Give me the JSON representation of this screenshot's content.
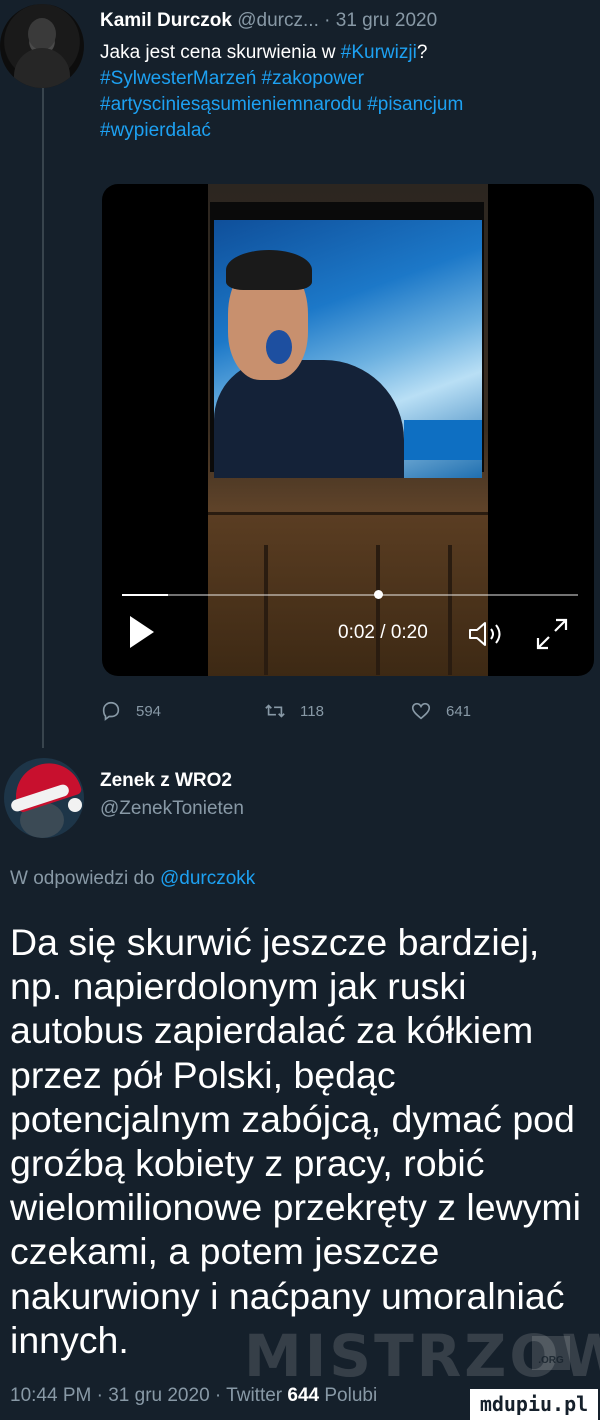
{
  "tweet": {
    "author_name": "Kamil Durczok",
    "author_handle": "@durcz...",
    "date": "· 31 gru 2020",
    "text_prefix": "Jaka jest cena skurwienia w ",
    "hashtag_kurwizji": "#Kurwizji",
    "text_q": "?",
    "hashtag_line2": "#SylwesterMarzeń #zakopower",
    "hashtag_line3": "#artysciniesąsumieniemnarodu #pisancjum",
    "hashtag_line4": "#wypierdalać"
  },
  "video": {
    "timecode": "0:02 / 0:20",
    "progress_fraction": 0.1,
    "play_icon": "play-icon",
    "volume_icon": "volume-icon",
    "expand_icon": "expand-icon"
  },
  "actions": {
    "reply_count": "594",
    "retweet_count": "118",
    "like_count": "641"
  },
  "reply": {
    "author_name": "Zenek z WRO2",
    "author_handle": "@ZenekTonieten",
    "replying_to_prefix": "W odpowiedzi do ",
    "replying_to_handle": "@durczokk",
    "text": "Da się skurwić jeszcze bardziej, np. napierdolonym jak ruski autobus zapierdalać za kółkiem przez pół Polski, będąc potencjalnym zabójcą, dymać pod groźbą kobiety z pracy, robić wielomilionowe przekręty z lewymi czekami, a potem jeszcze nakurwiony i naćpany umoralniać innych.",
    "footer_time": "10:44 PM · 31 gru 2020 · Twitter ",
    "footer_likes": "644",
    "footer_likes_label": " Polubi"
  },
  "watermark": {
    "text": "MISTRZOWIE",
    "org": ".ORG"
  },
  "badge": {
    "text": "mdupiu.pl"
  },
  "colors": {
    "background": "#15202b",
    "link": "#1da1f2",
    "muted": "#8899a6"
  }
}
